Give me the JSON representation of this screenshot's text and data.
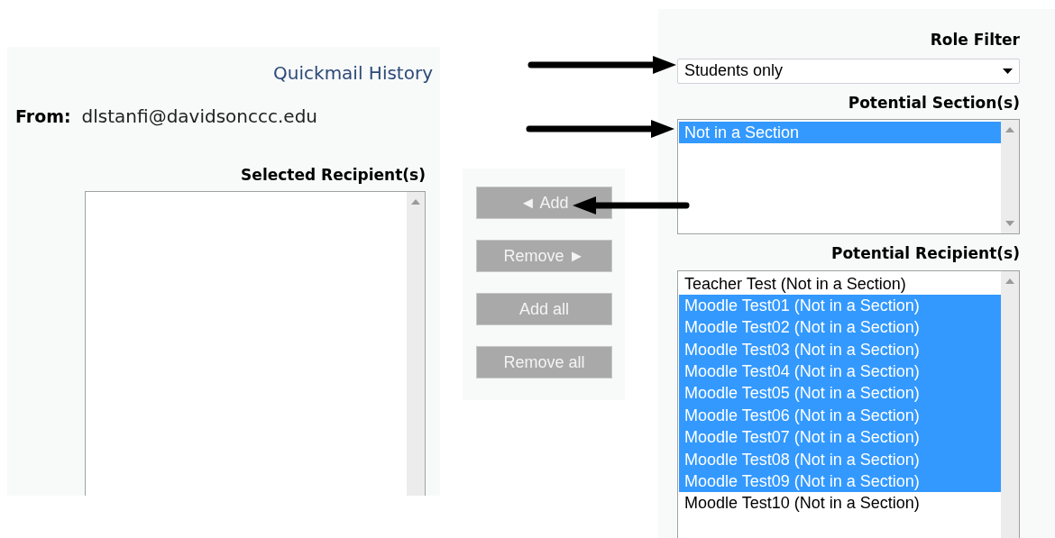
{
  "history_link": "Quickmail History",
  "from": {
    "label": "From:",
    "value": "dlstanfi@davidsonccc.edu"
  },
  "selected_recipients": {
    "label": "Selected Recipient(s)"
  },
  "buttons": [
    "◄ Add",
    "Remove ►",
    "Add all",
    "Remove all"
  ],
  "role_filter": {
    "label": "Role Filter",
    "value": "Students only"
  },
  "potential_sections": {
    "label": "Potential Section(s)",
    "items": [
      {
        "label": "Not in a Section",
        "selected": true
      }
    ]
  },
  "potential_recipients": {
    "label": "Potential Recipient(s)",
    "items": [
      {
        "label": "Teacher Test (Not in a Section)",
        "selected": false
      },
      {
        "label": "Moodle Test01 (Not in a Section)",
        "selected": true
      },
      {
        "label": "Moodle Test02 (Not in a Section)",
        "selected": true
      },
      {
        "label": "Moodle Test03 (Not in a Section)",
        "selected": true
      },
      {
        "label": "Moodle Test04 (Not in a Section)",
        "selected": true
      },
      {
        "label": "Moodle Test05 (Not in a Section)",
        "selected": true
      },
      {
        "label": "Moodle Test06 (Not in a Section)",
        "selected": true
      },
      {
        "label": "Moodle Test07 (Not in a Section)",
        "selected": true
      },
      {
        "label": "Moodle Test08 (Not in a Section)",
        "selected": true
      },
      {
        "label": "Moodle Test09 (Not in a Section)",
        "selected": true
      },
      {
        "label": "Moodle Test10 (Not in a Section)",
        "selected": false
      }
    ]
  }
}
